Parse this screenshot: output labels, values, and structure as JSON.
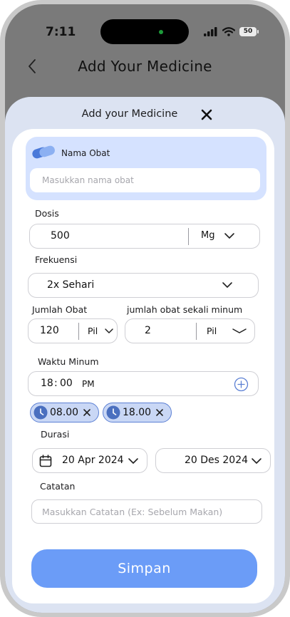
{
  "status_bar": {
    "time": "7:11",
    "battery": "50"
  },
  "header": {
    "title": "Add Your Medicine"
  },
  "sheet": {
    "title": "Add your Medicine"
  },
  "medicine_name": {
    "label": "Nama Obat",
    "placeholder": "Masukkan nama obat",
    "value": ""
  },
  "dose": {
    "label": "Dosis",
    "value": "500",
    "unit": "Mg"
  },
  "frequency": {
    "label": "Frekuensi",
    "value": "2x Sehari"
  },
  "amount": {
    "label": "Jumlah Obat",
    "value": "120",
    "unit": "Pil"
  },
  "amount_per_take": {
    "label": "jumlah obat sekali minum",
    "value": "2",
    "unit": "Pil"
  },
  "time": {
    "label": "Waktu Minum",
    "hour": "18",
    "separator": ":",
    "minute": "00",
    "period": "PM"
  },
  "times": [
    "08.00",
    "18.00"
  ],
  "duration": {
    "label": "Durasi",
    "start": "20 Apr 2024",
    "end": "20 Des 2024"
  },
  "notes": {
    "label": "Catatan",
    "placeholder": "Masukkan Catatan (Ex: Sebelum Makan)",
    "value": ""
  },
  "save_label": "Simpan",
  "colors": {
    "accent": "#6b9cf7",
    "chip_border": "#5c80d4",
    "chip_bg": "#c9d7f5",
    "name_box": "#d5e2ff",
    "sheet_bg": "#dce3f2"
  }
}
